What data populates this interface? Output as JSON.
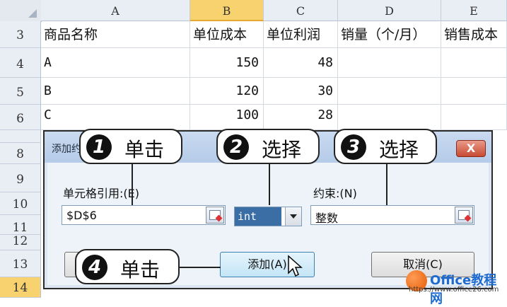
{
  "columns": [
    "A",
    "B",
    "C",
    "D",
    "E"
  ],
  "rows": [
    {
      "num": "3",
      "a": "商品名称",
      "b": "单位成本",
      "c": "单位利润",
      "d": "销量（个/月）",
      "e": "销售成本"
    },
    {
      "num": "4",
      "a": "A",
      "b": "150",
      "c": "48",
      "d": "",
      "e": ""
    },
    {
      "num": "5",
      "a": "B",
      "b": "120",
      "c": "30",
      "d": "",
      "e": ""
    },
    {
      "num": "6",
      "a": "C",
      "b": "100",
      "c": "28",
      "d": "",
      "e": ""
    }
  ],
  "hidden_rows": [
    "8",
    "9",
    "10",
    "11",
    "12",
    "13",
    "14"
  ],
  "dialog": {
    "title": "添加约",
    "close_label": "X",
    "cell_ref_label": "单元格引用:(E)",
    "cell_ref_value": "$D$6",
    "operator_value": "int",
    "constraint_label": "约束:(N)",
    "constraint_value": "整数",
    "add_label": "添加(A)",
    "cancel_label": "取消(C)"
  },
  "callouts": [
    {
      "num": "1",
      "text": "单击"
    },
    {
      "num": "2",
      "text": "选择"
    },
    {
      "num": "3",
      "text": "选择"
    },
    {
      "num": "4",
      "text": "单击"
    }
  ],
  "watermark": {
    "name": "Office教程网",
    "url": "https://www.office26.com"
  },
  "colors": {
    "selected_header": "#f8d26e",
    "dialog_bg": "#dce6f2",
    "close_button": "#c84b33"
  }
}
